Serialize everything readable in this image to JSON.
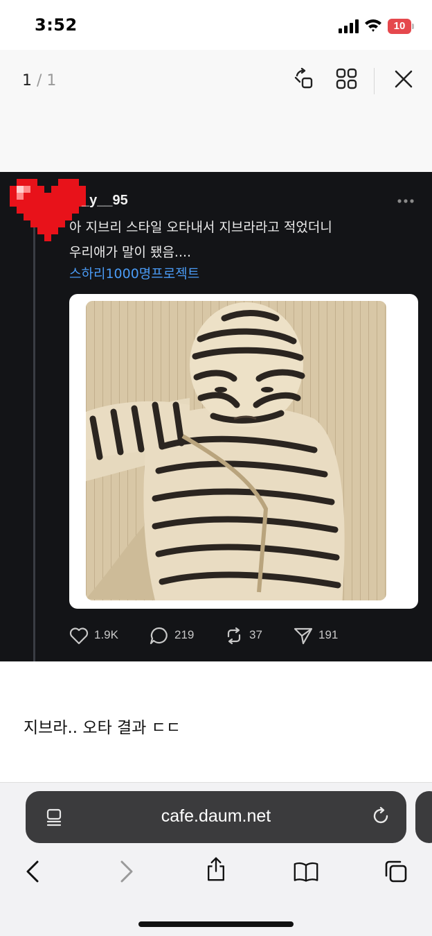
{
  "status_bar": {
    "time": "3:52",
    "battery_level": "10",
    "icons": [
      "signal-icon",
      "wifi-icon",
      "battery-icon"
    ]
  },
  "viewer": {
    "page_current": "1",
    "page_separator": "/",
    "page_total": "1",
    "icons": [
      "rotate-icon",
      "grid-icon",
      "close-icon"
    ]
  },
  "post": {
    "username": "_y__95",
    "text_line1": "아 지브리 스타일 오타내서 지브라라고 적었더니",
    "text_line2": "우리애가 말이 됐음....",
    "hashtag": "스하리1000명프로젝트",
    "avatar_icon": "pixel-heart-icon",
    "stats": {
      "likes": "1.9K",
      "replies": "219",
      "reposts": "37",
      "shares": "191"
    },
    "colors": {
      "background": "#131417",
      "hashtag": "#4a9bf5",
      "heart": "#e8121a"
    }
  },
  "caption": "지브라.. 오타 결과 ㄷㄷ",
  "browser": {
    "url": "cafe.daum.net",
    "toolbar_icons": [
      "back-icon",
      "forward-icon",
      "share-icon",
      "bookmarks-icon",
      "tabs-icon"
    ]
  }
}
